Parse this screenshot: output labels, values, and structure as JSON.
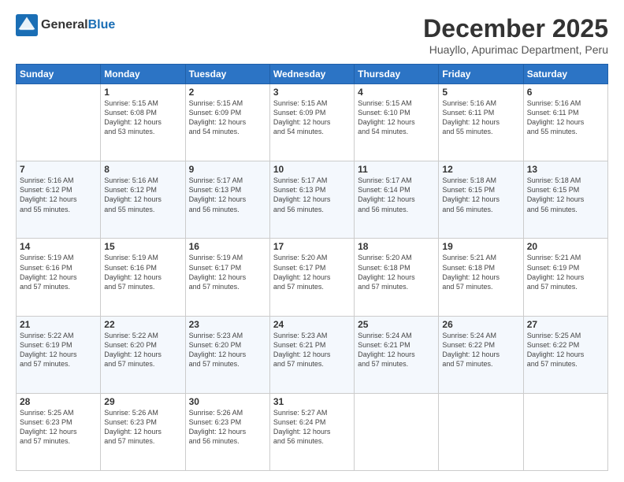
{
  "logo": {
    "line1": "General",
    "line2": "Blue"
  },
  "title": "December 2025",
  "subtitle": "Huayllo, Apurimac Department, Peru",
  "weekdays": [
    "Sunday",
    "Monday",
    "Tuesday",
    "Wednesday",
    "Thursday",
    "Friday",
    "Saturday"
  ],
  "weeks": [
    [
      {
        "day": "",
        "info": ""
      },
      {
        "day": "1",
        "info": "Sunrise: 5:15 AM\nSunset: 6:08 PM\nDaylight: 12 hours\nand 53 minutes."
      },
      {
        "day": "2",
        "info": "Sunrise: 5:15 AM\nSunset: 6:09 PM\nDaylight: 12 hours\nand 54 minutes."
      },
      {
        "day": "3",
        "info": "Sunrise: 5:15 AM\nSunset: 6:09 PM\nDaylight: 12 hours\nand 54 minutes."
      },
      {
        "day": "4",
        "info": "Sunrise: 5:15 AM\nSunset: 6:10 PM\nDaylight: 12 hours\nand 54 minutes."
      },
      {
        "day": "5",
        "info": "Sunrise: 5:16 AM\nSunset: 6:11 PM\nDaylight: 12 hours\nand 55 minutes."
      },
      {
        "day": "6",
        "info": "Sunrise: 5:16 AM\nSunset: 6:11 PM\nDaylight: 12 hours\nand 55 minutes."
      }
    ],
    [
      {
        "day": "7",
        "info": "Sunrise: 5:16 AM\nSunset: 6:12 PM\nDaylight: 12 hours\nand 55 minutes."
      },
      {
        "day": "8",
        "info": "Sunrise: 5:16 AM\nSunset: 6:12 PM\nDaylight: 12 hours\nand 55 minutes."
      },
      {
        "day": "9",
        "info": "Sunrise: 5:17 AM\nSunset: 6:13 PM\nDaylight: 12 hours\nand 56 minutes."
      },
      {
        "day": "10",
        "info": "Sunrise: 5:17 AM\nSunset: 6:13 PM\nDaylight: 12 hours\nand 56 minutes."
      },
      {
        "day": "11",
        "info": "Sunrise: 5:17 AM\nSunset: 6:14 PM\nDaylight: 12 hours\nand 56 minutes."
      },
      {
        "day": "12",
        "info": "Sunrise: 5:18 AM\nSunset: 6:15 PM\nDaylight: 12 hours\nand 56 minutes."
      },
      {
        "day": "13",
        "info": "Sunrise: 5:18 AM\nSunset: 6:15 PM\nDaylight: 12 hours\nand 56 minutes."
      }
    ],
    [
      {
        "day": "14",
        "info": "Sunrise: 5:19 AM\nSunset: 6:16 PM\nDaylight: 12 hours\nand 57 minutes."
      },
      {
        "day": "15",
        "info": "Sunrise: 5:19 AM\nSunset: 6:16 PM\nDaylight: 12 hours\nand 57 minutes."
      },
      {
        "day": "16",
        "info": "Sunrise: 5:19 AM\nSunset: 6:17 PM\nDaylight: 12 hours\nand 57 minutes."
      },
      {
        "day": "17",
        "info": "Sunrise: 5:20 AM\nSunset: 6:17 PM\nDaylight: 12 hours\nand 57 minutes."
      },
      {
        "day": "18",
        "info": "Sunrise: 5:20 AM\nSunset: 6:18 PM\nDaylight: 12 hours\nand 57 minutes."
      },
      {
        "day": "19",
        "info": "Sunrise: 5:21 AM\nSunset: 6:18 PM\nDaylight: 12 hours\nand 57 minutes."
      },
      {
        "day": "20",
        "info": "Sunrise: 5:21 AM\nSunset: 6:19 PM\nDaylight: 12 hours\nand 57 minutes."
      }
    ],
    [
      {
        "day": "21",
        "info": "Sunrise: 5:22 AM\nSunset: 6:19 PM\nDaylight: 12 hours\nand 57 minutes."
      },
      {
        "day": "22",
        "info": "Sunrise: 5:22 AM\nSunset: 6:20 PM\nDaylight: 12 hours\nand 57 minutes."
      },
      {
        "day": "23",
        "info": "Sunrise: 5:23 AM\nSunset: 6:20 PM\nDaylight: 12 hours\nand 57 minutes."
      },
      {
        "day": "24",
        "info": "Sunrise: 5:23 AM\nSunset: 6:21 PM\nDaylight: 12 hours\nand 57 minutes."
      },
      {
        "day": "25",
        "info": "Sunrise: 5:24 AM\nSunset: 6:21 PM\nDaylight: 12 hours\nand 57 minutes."
      },
      {
        "day": "26",
        "info": "Sunrise: 5:24 AM\nSunset: 6:22 PM\nDaylight: 12 hours\nand 57 minutes."
      },
      {
        "day": "27",
        "info": "Sunrise: 5:25 AM\nSunset: 6:22 PM\nDaylight: 12 hours\nand 57 minutes."
      }
    ],
    [
      {
        "day": "28",
        "info": "Sunrise: 5:25 AM\nSunset: 6:23 PM\nDaylight: 12 hours\nand 57 minutes."
      },
      {
        "day": "29",
        "info": "Sunrise: 5:26 AM\nSunset: 6:23 PM\nDaylight: 12 hours\nand 57 minutes."
      },
      {
        "day": "30",
        "info": "Sunrise: 5:26 AM\nSunset: 6:23 PM\nDaylight: 12 hours\nand 56 minutes."
      },
      {
        "day": "31",
        "info": "Sunrise: 5:27 AM\nSunset: 6:24 PM\nDaylight: 12 hours\nand 56 minutes."
      },
      {
        "day": "",
        "info": ""
      },
      {
        "day": "",
        "info": ""
      },
      {
        "day": "",
        "info": ""
      }
    ]
  ]
}
